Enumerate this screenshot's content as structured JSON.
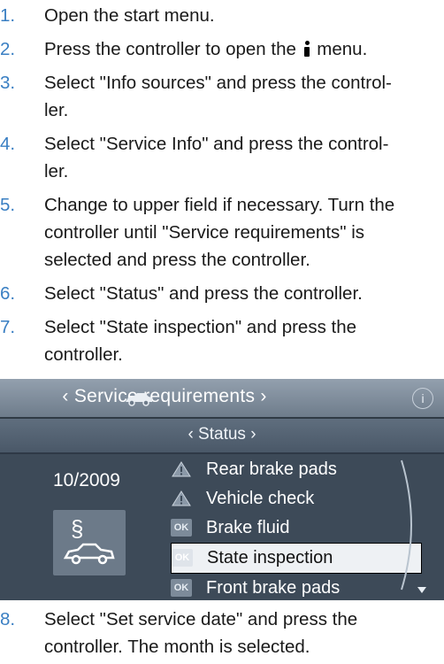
{
  "steps": [
    {
      "num": "1.",
      "text": "Open the start menu."
    },
    {
      "num": "2.",
      "text_before": "Press the controller to open the ",
      "text_after": " menu."
    },
    {
      "num": "3.",
      "text": "Select \"Info sources\" and press the control-\nler."
    },
    {
      "num": "4.",
      "text": "Select \"Service Info\" and press the control-\nler."
    },
    {
      "num": "5.",
      "text": "Change to upper field if necessary. Turn the\ncontroller until \"Service requirements\" is\nselected and press the controller."
    },
    {
      "num": "6.",
      "text": "Select \"Status\" and press the controller."
    },
    {
      "num": "7.",
      "text": "Select \"State inspection\" and press the\ncontroller."
    },
    {
      "num": "8.",
      "text": "Select \"Set service date\" and press the\ncontroller. The month is selected."
    }
  ],
  "screen": {
    "title": "‹  Service requirements  ›",
    "info_badge": "i",
    "subtitle": "‹  Status  ›",
    "date": "10/2009",
    "items": [
      {
        "status": "warning",
        "label": "Rear brake pads"
      },
      {
        "status": "warning",
        "label": "Vehicle check"
      },
      {
        "status": "ok",
        "mark": "OK",
        "label": "Brake fluid"
      },
      {
        "status": "ok",
        "mark": "OK",
        "label": "State inspection",
        "selected": true
      },
      {
        "status": "ok",
        "mark": "OK",
        "label": "Front brake pads"
      }
    ]
  },
  "colors": {
    "step_number": "#3a7fc3",
    "panel_background": "#3d4a58",
    "selection": "#eef1f4"
  }
}
